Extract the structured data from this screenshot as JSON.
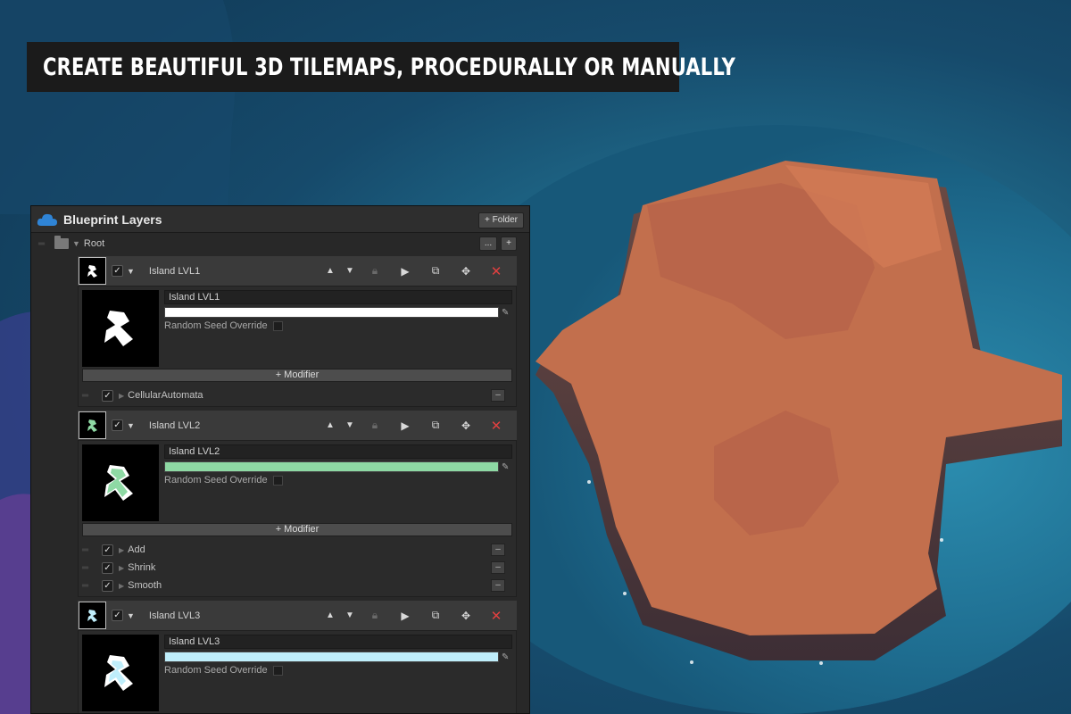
{
  "banner": {
    "title": "CREATE BEAUTIFUL 3D TILEMAPS, PROCEDURALLY OR MANUALLY"
  },
  "panel": {
    "title": "Blueprint Layers",
    "folder_button": "+ Folder",
    "root_label": "Root",
    "root_more": "...",
    "root_add": "+",
    "modifier_button": "+ Modifier",
    "seed_label": "Random Seed Override",
    "layers": [
      {
        "name": "Island LVL1",
        "color": "#ffffff",
        "modifiers": [
          "CellularAutomata"
        ]
      },
      {
        "name": "Island LVL2",
        "color": "#8ed9a4",
        "modifiers": [
          "Add",
          "Shrink",
          "Smooth"
        ]
      },
      {
        "name": "Island LVL3",
        "color": "#bfeefb",
        "modifiers": []
      }
    ]
  },
  "colors": {
    "accent_red": "#e04040",
    "ocean": "#1d6383",
    "land": "#c06a4a"
  }
}
